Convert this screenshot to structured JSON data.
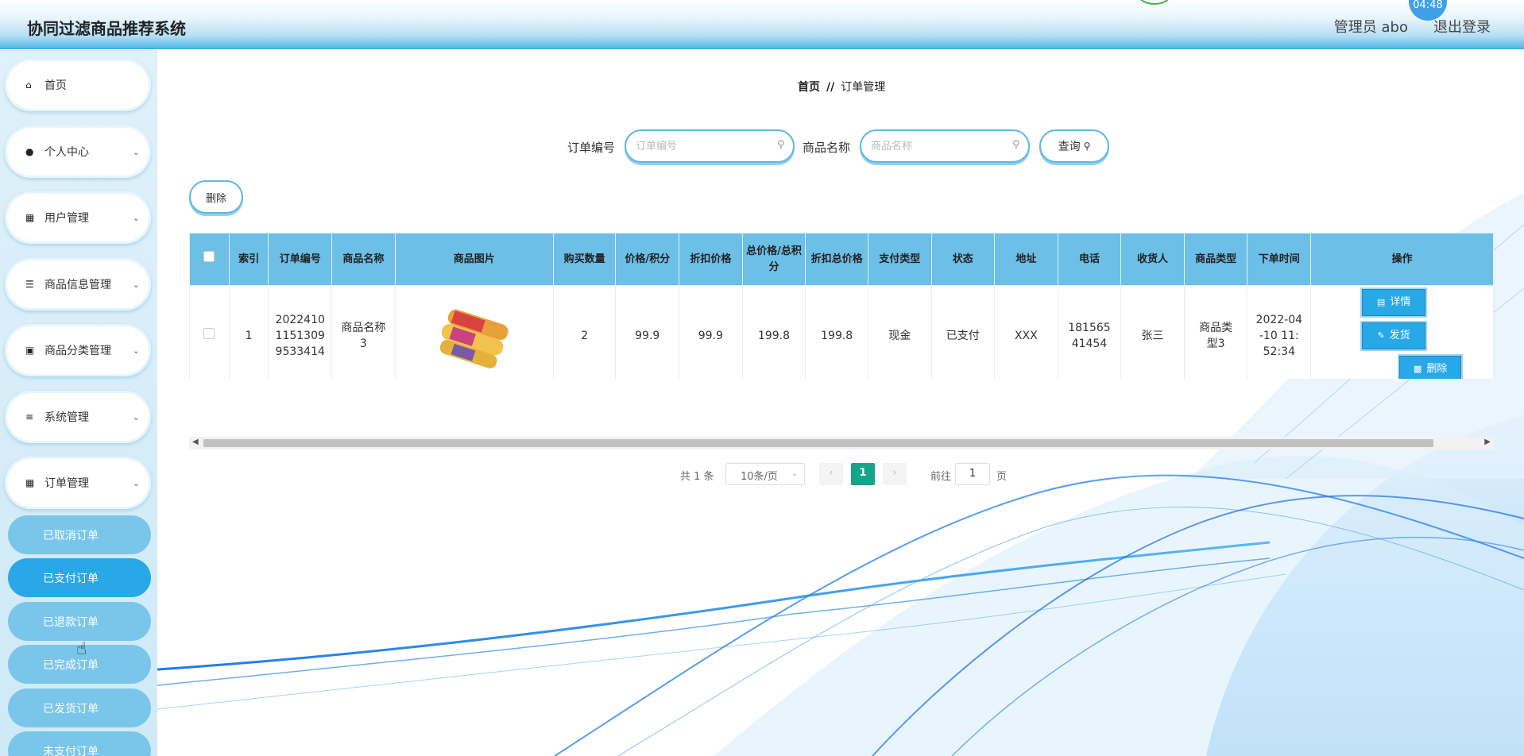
{
  "header": {
    "title": "协同过滤商品推荐系统",
    "user_label": "管理员 abo",
    "logout": "退出登录",
    "time": "04:48"
  },
  "sidebar": {
    "items": [
      {
        "label": "首页",
        "icon": "home-icon"
      },
      {
        "label": "个人中心",
        "icon": "user-icon"
      },
      {
        "label": "用户管理",
        "icon": "grid-icon"
      },
      {
        "label": "商品信息管理",
        "icon": "list-icon"
      },
      {
        "label": "商品分类管理",
        "icon": "monitor-icon"
      },
      {
        "label": "系统管理",
        "icon": "sliders-icon"
      },
      {
        "label": "订单管理",
        "icon": "grid-icon"
      }
    ],
    "sub_items": [
      {
        "label": "已取消订单"
      },
      {
        "label": "已支付订单"
      },
      {
        "label": "已退款订单"
      },
      {
        "label": "已完成订单"
      },
      {
        "label": "已发货订单"
      },
      {
        "label": "未支付订单"
      }
    ],
    "active_sub": "已支付订单"
  },
  "breadcrumb": {
    "home": "首页",
    "separator": "//",
    "current": "订单管理"
  },
  "search": {
    "order_no_label": "订单编号",
    "order_no_placeholder": "订单编号",
    "product_name_label": "商品名称",
    "product_name_placeholder": "商品名称",
    "query_button": "查询"
  },
  "toolbar": {
    "delete_button": "删除"
  },
  "table": {
    "headers": [
      "",
      "索引",
      "订单编号",
      "商品名称",
      "商品图片",
      "购买数量",
      "价格/积分",
      "折扣价格",
      "总价格/总积分",
      "折扣总价格",
      "支付类型",
      "状态",
      "地址",
      "电话",
      "收货人",
      "商品类型",
      "下单时间",
      "操作"
    ],
    "rows": [
      {
        "index": "1",
        "order_no": "20224101151309 9533414",
        "product_name": "商品名称3",
        "quantity": "2",
        "price": "99.9",
        "discount_price": "99.9",
        "total_price": "199.8",
        "discount_total": "199.8",
        "payment_type": "现金",
        "status": "已支付",
        "address": "XXX",
        "phone": "18156541454",
        "receiver": "张三",
        "product_type": "商品类型3",
        "order_time": "2022-04-10 11:52:34",
        "actions": {
          "detail": "详情",
          "ship": "发货",
          "delete": "删除"
        }
      }
    ]
  },
  "pagination": {
    "total": "共 1 条",
    "page_size": "10条/页",
    "current_page": "1",
    "goto_label": "前往",
    "goto_value": "1",
    "page_suffix": "页"
  },
  "colors": {
    "accent": "#29a8e8",
    "header_th": "#6cbfe6",
    "pager_active": "#14a58a"
  }
}
